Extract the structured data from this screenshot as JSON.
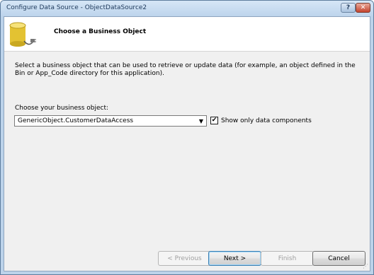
{
  "window": {
    "title": "Configure Data Source - ObjectDataSource2",
    "help_label": "?",
    "close_label": "✕"
  },
  "header": {
    "icon": "database-plug-icon",
    "title": "Choose a Business Object"
  },
  "main": {
    "description": "Select a business object that can be used to retrieve or update data (for example, an object defined in the Bin or App_Code directory for this application).",
    "combo_label": "Choose your business object:",
    "combo_value": "GenericObject.CustomerDataAccess",
    "checkbox_label": "Show only data components",
    "checkbox_checked": true,
    "checkmark": "✔"
  },
  "footer": {
    "previous_label": "< Previous",
    "next_label": "Next >",
    "finish_label": "Finish",
    "cancel_label": "Cancel"
  },
  "colors": {
    "title_text": "#1e395b",
    "close_button": "#c4432d",
    "default_button_border": "#3c7fb1"
  }
}
